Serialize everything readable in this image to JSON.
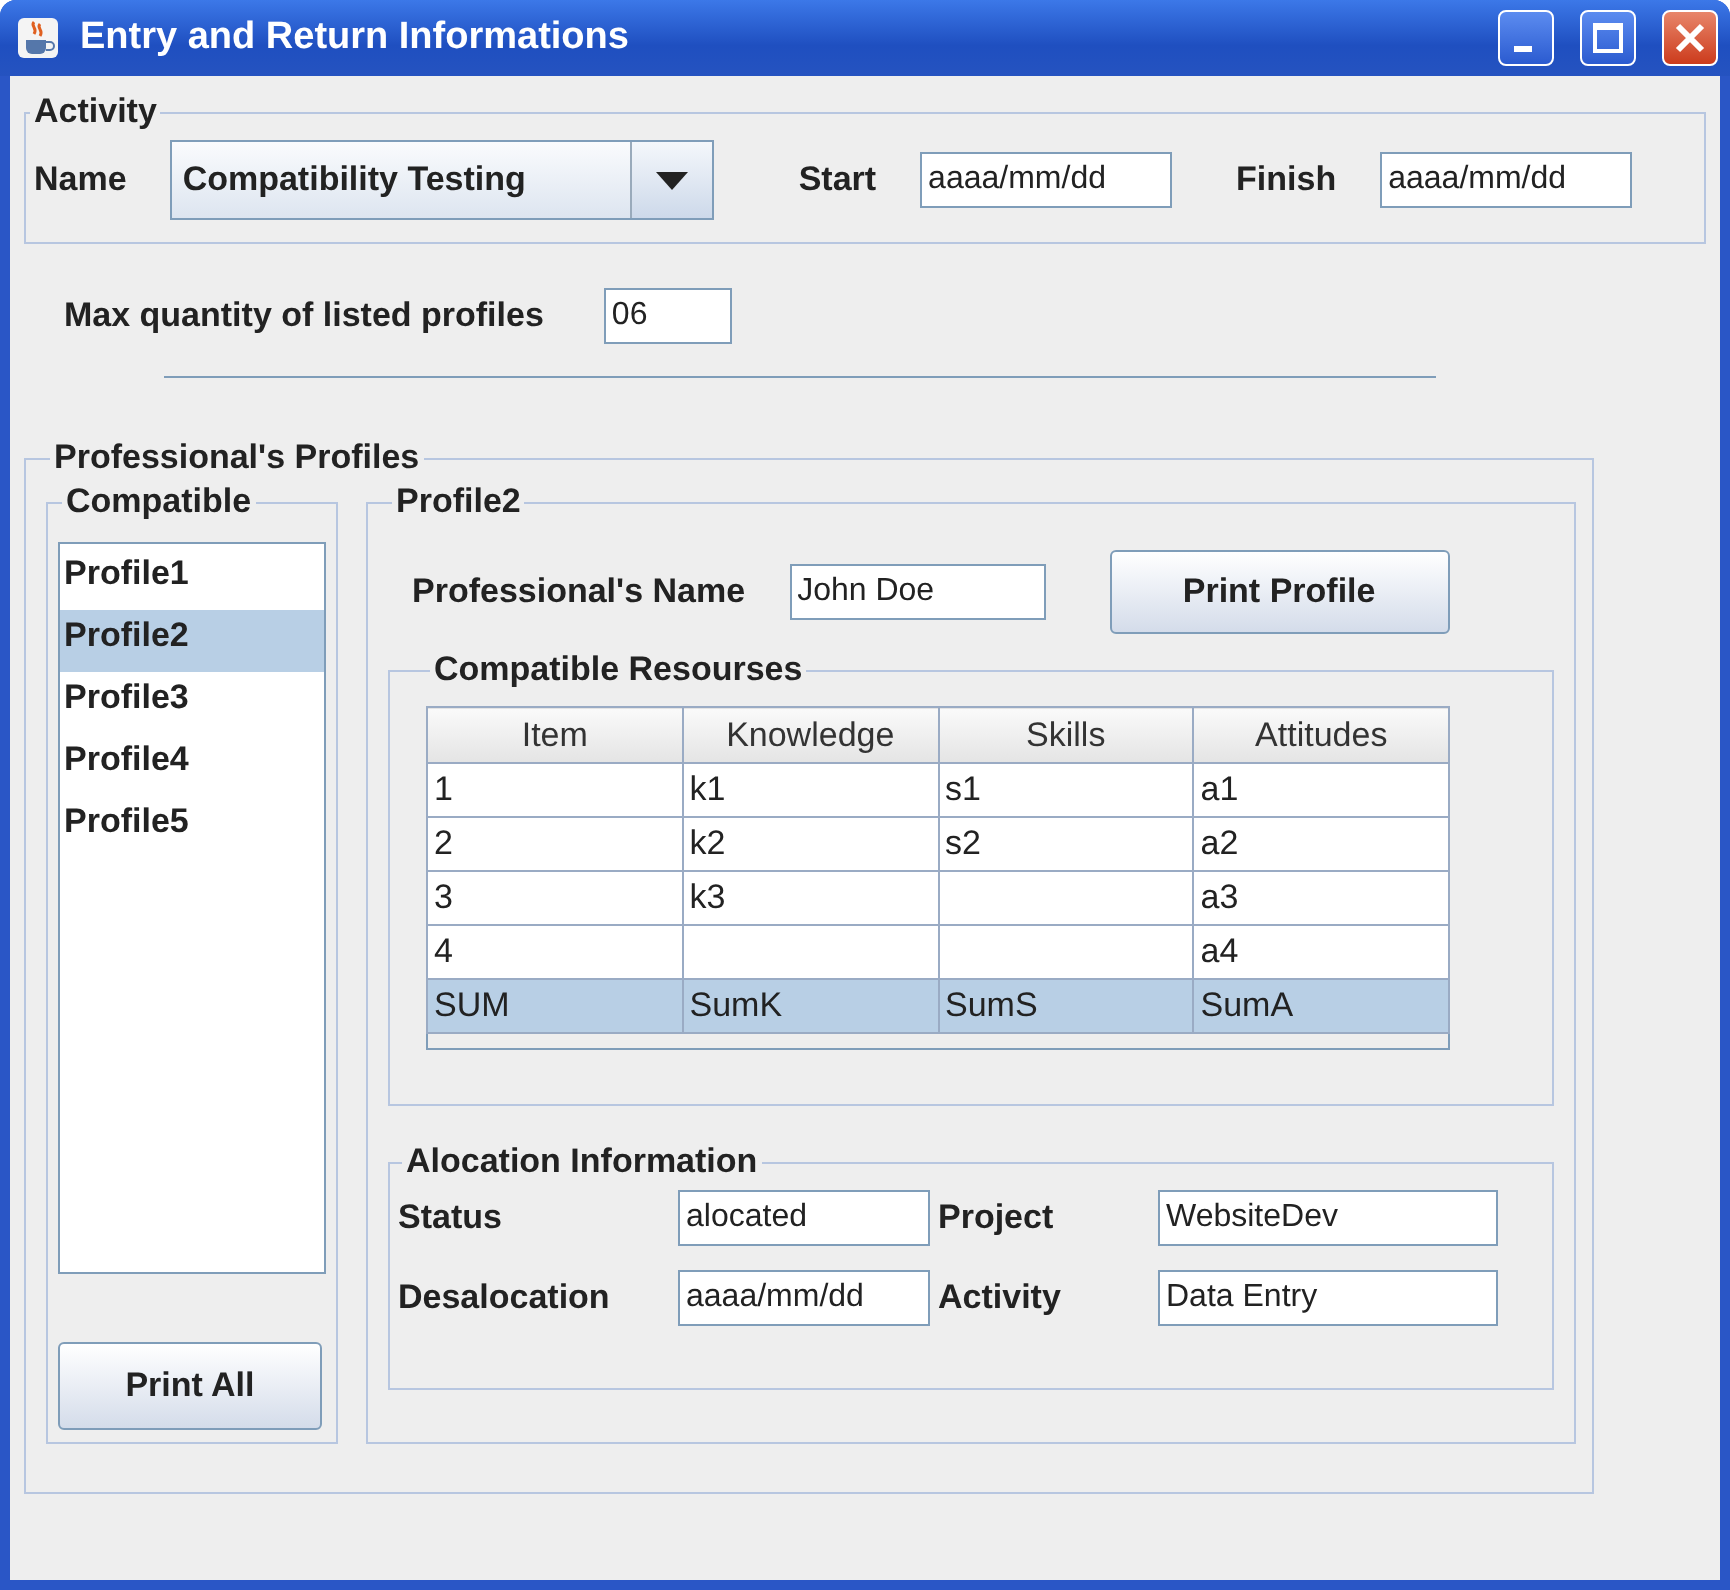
{
  "window": {
    "title": "Entry and Return Informations"
  },
  "activity": {
    "legend": "Activity",
    "name_label": "Name",
    "name_value": "Compatibility Testing",
    "start_label": "Start",
    "start_value": "aaaa/mm/dd",
    "finish_label": "Finish",
    "finish_value": "aaaa/mm/dd"
  },
  "max_profiles": {
    "label": "Max quantity of listed profiles",
    "value": "06"
  },
  "profiles_panel": {
    "legend": "Professional's Profiles",
    "compatible": {
      "legend": "Compatible",
      "items": [
        {
          "label": "Profile1",
          "selected": false
        },
        {
          "label": "Profile2",
          "selected": true
        },
        {
          "label": "Profile3",
          "selected": false
        },
        {
          "label": "Profile4",
          "selected": false
        },
        {
          "label": "Profile5",
          "selected": false
        }
      ],
      "button": "Print All"
    },
    "profile": {
      "legend": "Profile2",
      "name_label": "Professional's Name",
      "name_value": "John Doe",
      "button": "Print Profile",
      "resources": {
        "legend": "Compatible Resourses",
        "columns": [
          "Item",
          "Knowledge",
          "Skills",
          "Attitudes"
        ],
        "rows": [
          {
            "cells": [
              "1",
              "k1",
              "s1",
              "a1"
            ],
            "selected": false
          },
          {
            "cells": [
              "2",
              "k2",
              "s2",
              "a2"
            ],
            "selected": false
          },
          {
            "cells": [
              "3",
              "k3",
              null,
              "a3"
            ],
            "selected": false
          },
          {
            "cells": [
              "4",
              null,
              null,
              "a4"
            ],
            "selected": false
          },
          {
            "cells": [
              "SUM",
              "SumK",
              "SumS",
              "SumA"
            ],
            "selected": true
          }
        ]
      },
      "allocation": {
        "legend": "Alocation Information",
        "fields": [
          {
            "label": "Status",
            "value": "alocated"
          },
          {
            "label": "Project",
            "value": "WebsiteDev"
          },
          {
            "label": "Desalocation",
            "value": "aaaa/mm/dd"
          },
          {
            "label": "Activity",
            "value": "Data Entry"
          }
        ]
      }
    }
  }
}
